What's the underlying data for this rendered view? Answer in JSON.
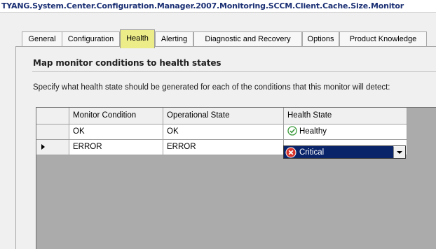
{
  "window": {
    "title": "TYANG.System.Center.Configuration.Manager.2007.Monitoring.SCCM.Client.Cache.Size.Monitor"
  },
  "tabs": [
    {
      "label": "General",
      "active": false
    },
    {
      "label": "Configuration",
      "active": false
    },
    {
      "label": "Health",
      "active": true
    },
    {
      "label": "Alerting",
      "active": false
    },
    {
      "label": "Diagnostic and Recovery",
      "active": false
    },
    {
      "label": "Options",
      "active": false
    },
    {
      "label": "Product Knowledge",
      "active": false
    }
  ],
  "section": {
    "heading": "Map monitor conditions to health states",
    "description": "Specify what health state should be generated for each of the conditions that this monitor will detect:"
  },
  "grid": {
    "columns": [
      "Monitor Condition",
      "Operational State",
      "Health State"
    ],
    "rows": [
      {
        "monitor_condition": "OK",
        "operational_state": "OK",
        "health_state": "Healthy",
        "health_icon": "healthy-check-icon",
        "selected": false
      },
      {
        "monitor_condition": "ERROR",
        "operational_state": "ERROR",
        "health_state": "Critical",
        "health_icon": "critical-x-icon",
        "selected": true
      }
    ]
  },
  "colors": {
    "active_tab": "#ecec88",
    "selection": "#0a246a",
    "healthy": "#3a9a3a",
    "critical": "#d9342b",
    "title_text": "#1a2f73"
  }
}
